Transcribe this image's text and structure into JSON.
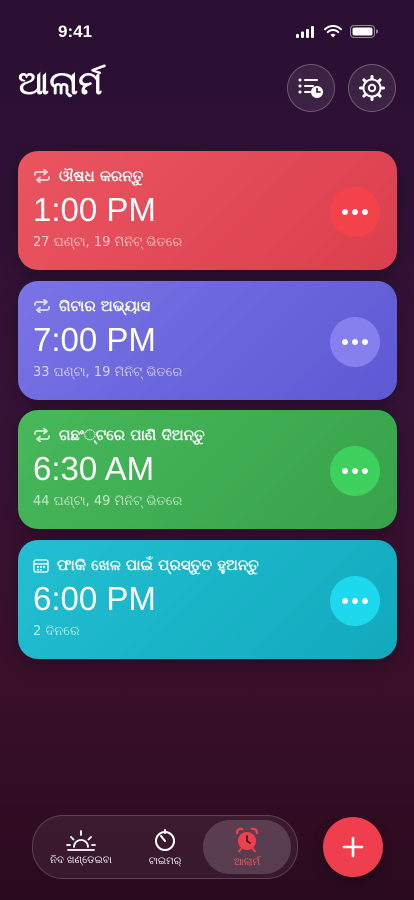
{
  "status": {
    "time": "9:41"
  },
  "header": {
    "title": "ଆଲାର୍ମ"
  },
  "alarms": [
    {
      "label": "ଔଷଧ କରନ୍ତୁ",
      "time": "1:00 PM",
      "sub": "27 ଘଣ୍ଟା, 19 ମିନିଟ୍ ଭିତରେ",
      "icon": "repeat-icon",
      "color": "#e34b57"
    },
    {
      "label": "ଗିଟାର ଅଭ୍ୟାସ",
      "time": "7:00 PM",
      "sub": "33 ଘଣ୍ଟା, 19 ମିନିଟ୍ ଭିତରେ",
      "icon": "repeat-icon",
      "color": "#6c66dd"
    },
    {
      "label": "ଗଛଂ୍ଟରେ ପାଣି ଦିଅନ୍ତୁ",
      "time": "6:30 AM",
      "sub": "44 ଘଣ୍ଟା, 49 ମିନିଟ୍ ଭିତରେ",
      "icon": "repeat-icon",
      "color": "#3fae53"
    },
    {
      "label": "ଫାକି ଖେଳ ପାଇଁ ପ୍ରସ୍ତୁତ ହୁଅନ୍ତୁ",
      "time": "6:00 PM",
      "sub": "2 ଦିନରେ",
      "icon": "calendar-icon",
      "color": "#19b9cc"
    }
  ],
  "tabs": [
    {
      "label": "ନିଦ ଖଣ୍ଡେଇବା",
      "icon": "sunrise-icon",
      "active": false
    },
    {
      "label": "ଟାଇମର୍",
      "icon": "timer-icon",
      "active": false
    },
    {
      "label": "ଆଲାର୍ମ",
      "icon": "alarm-clock-icon",
      "active": true
    }
  ],
  "fab": {
    "label": "+"
  }
}
